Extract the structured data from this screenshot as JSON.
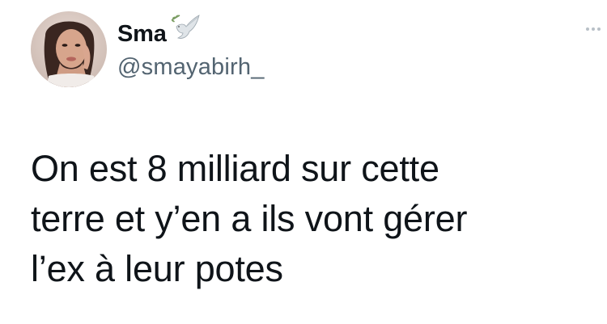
{
  "author": {
    "display_name": "Sma",
    "handle": "@smayabirh_",
    "name_icon": "dove-icon",
    "avatar_icon": "avatar"
  },
  "tweet": {
    "text": "On est 8 milliard sur cette\nterre et y’en a ils vont gérer\nl’ex à leur potes"
  },
  "menu": {
    "icon": "more-options-icon"
  }
}
